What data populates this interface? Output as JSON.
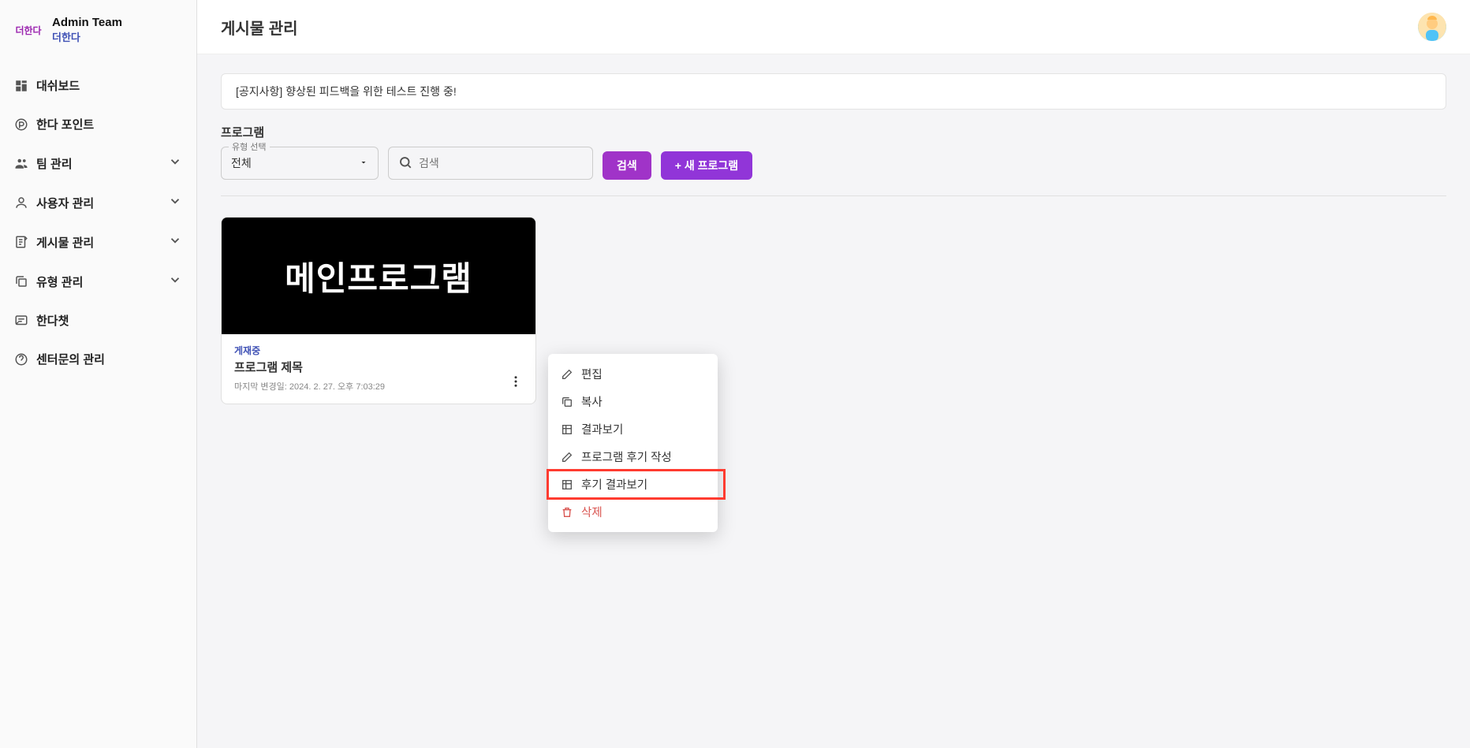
{
  "brand": {
    "top": "Admin Team",
    "bottom": "더한다",
    "logo_text": "더한다"
  },
  "sidebar": {
    "items": [
      {
        "label": "대쉬보드",
        "icon": "dashboard-icon",
        "expandable": false
      },
      {
        "label": "한다 포인트",
        "icon": "coin-icon",
        "expandable": false
      },
      {
        "label": "팀 관리",
        "icon": "people-icon",
        "expandable": true
      },
      {
        "label": "사용자 관리",
        "icon": "person-icon",
        "expandable": true
      },
      {
        "label": "게시물 관리",
        "icon": "post-icon",
        "expandable": true
      },
      {
        "label": "유형 관리",
        "icon": "copy-icon",
        "expandable": true
      },
      {
        "label": "한다챗",
        "icon": "chat-icon",
        "expandable": false
      },
      {
        "label": "센터문의 관리",
        "icon": "help-icon",
        "expandable": false
      }
    ]
  },
  "page": {
    "title": "게시물 관리"
  },
  "notice": "[공지사항] 향상된 피드백을 위한 테스트 진행 중!",
  "section": {
    "label": "프로그램",
    "type_float": "유형 선택",
    "type_value": "전체",
    "search_placeholder": "검색",
    "search_btn": "검색",
    "new_btn": "+ 새 프로그램"
  },
  "card": {
    "image_text": "메인프로그램",
    "status": "게재중",
    "title": "프로그램 제목",
    "meta": "마지막 변경일: 2024. 2. 27. 오후 7:03:29"
  },
  "menu": {
    "edit": "편집",
    "copy": "복사",
    "results": "결과보기",
    "write_review": "프로그램 후기 작성",
    "review_results": "후기 결과보기",
    "delete": "삭제"
  }
}
